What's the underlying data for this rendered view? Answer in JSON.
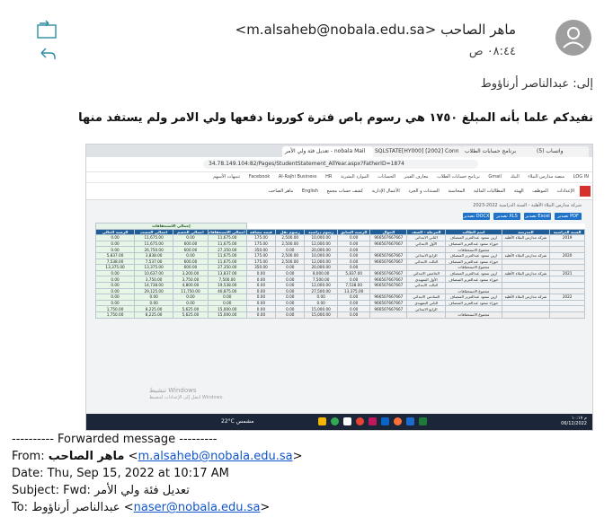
{
  "sender": {
    "name": "ماهر الصاحب",
    "email": "m.alsaheb@nobala.edu.sa",
    "time": "٠٨:٤٤ ص"
  },
  "to_line": "إلى: عبدالناصر أرناؤوط",
  "message_body": "نفيدكم علما بأنه المبلغ ١٧٥٠ هي رسوم باص فترة كورونا دفعها ولي الامر ولم يستفد منها",
  "screenshot": {
    "tabs": [
      "(5) واتساب",
      "برنامج حسابات الطلاب",
      "SQLSTATE[HY000] [2002] Conn",
      "تعديل فئة ولي الأمر - nobala Mail"
    ],
    "url": "34.78.149.104:82/Pages/StudentStatement_AllYear.aspx?FatherID=1874",
    "bookmarks": [
      "LOG IN",
      "منصة مدارس النبلاء",
      "البنك",
      "Gmail",
      "برنامج حسابات الطلاب",
      "معارف الفيتر",
      "الحسابات",
      "الموارد البشرية",
      "HR",
      "Al-Rajhi Business",
      "Facebook",
      "تنبيهات الأسهم"
    ],
    "nav_items": [
      "الإعدادات",
      "الموظف",
      "الهيئة",
      "المطالبات المالية",
      "المحاسبة",
      "السندات و الجرد",
      "الأعمال الإدارية",
      "كشف حساب مجمع",
      "English",
      "ماهر الصاحب"
    ],
    "crumb": "شركة مدارس النبلاء الأهلية - السنة الدراسية 2022-2023",
    "buttons": [
      "تصدير PDF",
      "تصدير Excel",
      "تصدير XLS",
      "تصدير DOCX"
    ],
    "column_headers": [
      "السنة الدراسية",
      "المدرسة",
      "اسم الطالب",
      "المرحلة - الصف",
      "الجوال",
      "الرصيد السابق",
      "رسوم دراسية",
      "رسوم نقل",
      "قيمة مضافة",
      "اجمالي الاستحقاقات",
      "اجمالي الخصم",
      "اجمالي المسدد",
      "الرصيد الحالي"
    ],
    "group_header": "إجمالي الاستحقاقات",
    "years": [
      "2019",
      "2020",
      "2021",
      "2022"
    ],
    "school": "شركة مدارس النبلاء الأهلية",
    "rows": [
      [
        "",
        "",
        "ارين سعود عبدالعزيز المنصاف",
        "الثاني الابتدائي",
        "966507667667",
        "0.00",
        "10,000.00",
        "2,500.00",
        "175.00",
        "11,675.00",
        "0.00",
        "11,675.00",
        "0.00"
      ],
      [
        "",
        "",
        "حوراء سعود عبدالعزيز المنصاف",
        "الأول الابتدائي",
        "966507667667",
        "0.00",
        "12,000.00",
        "2,500.00",
        "175.00",
        "11,675.00",
        "600.00",
        "11,675.00",
        "0.00"
      ],
      [
        "",
        "",
        "مجموع الاستحقاقات",
        "",
        "",
        "0.00",
        "20,000.00",
        "0.00",
        "350.00",
        "27,350.00",
        "600.00",
        "26,750.00",
        "0.00"
      ],
      [
        "",
        "",
        "ارين سعود عبدالعزيز المنصاف",
        "الرابع الابتدائي",
        "966507667667",
        "0.00",
        "10,000.00",
        "2,500.00",
        "175.00",
        "11,675.00",
        "0.00",
        "3,838.00",
        "5,837.00"
      ],
      [
        "",
        "",
        "حوراء سعود عبدالعزيز المنصاف",
        "الثالث الابتدائي",
        "966507667667",
        "0.00",
        "12,000.00",
        "2,500.00",
        "175.00",
        "11,675.00",
        "600.00",
        "7,537.00",
        "7,538.00"
      ],
      [
        "",
        "",
        "مجموع الاستحقاقات",
        "",
        "",
        "0.00",
        "20,000.00",
        "0.00",
        "350.00",
        "27,350.00",
        "600.00",
        "13,375.00",
        "13,375.00"
      ],
      [
        "",
        "",
        "ارين سعود عبدالعزيز المنصاف",
        "الخامس الابتدائي",
        "966507667667",
        "5,837.00",
        "8,000.00",
        "0.00",
        "0.00",
        "13,837.00",
        "3,200.00",
        "10,637.00",
        "0.00"
      ],
      [
        "",
        "",
        "حوراء سعود عبدالعزيز المنصاف",
        "الأول التمهيدي",
        "966507667667",
        "0.00",
        "7,500.00",
        "0.00",
        "0.00",
        "7,500.00",
        "3,750.00",
        "3,750.00",
        "0.00"
      ],
      [
        "",
        "",
        "",
        "الثالث الابتدائي",
        "966507667667",
        "7,538.00",
        "12,000.00",
        "0.00",
        "0.00",
        "19,538.00",
        "4,800.00",
        "14,738.00",
        "0.00"
      ],
      [
        "",
        "",
        "مجموع الاستحقاقات",
        "",
        "",
        "13,375.00",
        "27,500.00",
        "0.00",
        "0.00",
        "40,875.00",
        "11,750.00",
        "29,125.00",
        "0.00"
      ],
      [
        "",
        "",
        "ارين سعود عبدالعزيز المنصاف",
        "السادس الابتدائي",
        "966507667667",
        "0.00",
        "0.00",
        "0.00",
        "0.00",
        "0.00",
        "0.00",
        "0.00",
        "0.00"
      ],
      [
        "",
        "",
        "حوراء سعود عبدالعزيز المنصاف",
        "الثاني التمهيدي",
        "966507667667",
        "0.00",
        "0.00",
        "0.00",
        "0.00",
        "0.00",
        "0.00",
        "0.00",
        "0.00"
      ],
      [
        "",
        "",
        "",
        "الرابع الابتدائي",
        "966507667667",
        "0.00",
        "15,000.00",
        "0.00",
        "0.00",
        "15,000.00",
        "5,625.00",
        "8,225.00",
        "1,750.00"
      ],
      [
        "",
        "",
        "مجموع الاستحقاقات",
        "",
        "",
        "0.00",
        "15,000.00",
        "0.00",
        "0.00",
        "15,000.00",
        "5,625.00",
        "8,225.00",
        "1,750.00"
      ]
    ],
    "watermark": "تنشيط Windows",
    "watermark_sub": "انتقل إلى الإعدادات لتنشيط Windows.",
    "taskbar_weather": "22°C مشمس",
    "taskbar_time": "م ١٠:١٧",
    "taskbar_date": "06/12/2022"
  },
  "forwarded": {
    "divider": "---------- Forwarded message ---------",
    "from_label": "From: ",
    "from_name": "ماهر الصاحب",
    "from_email": "m.alsaheb@nobala.edu.sa",
    "date": "Date: Thu, Sep 15, 2022 at 10:17 AM",
    "subject_label": "Subject: Fwd: ",
    "subject": "تعديل فئة ولي الأمر",
    "to_label": "To: ",
    "to_name": "عبدالناصر أرناؤوط",
    "to_email": "naser@nobala.edu.sa"
  },
  "colors": {
    "avatar": "#9e9e9e",
    "link": "#1155cc",
    "icon_teal": "#00838f",
    "table_header": "#1f5e99",
    "green_cell": "#e8f6e8"
  }
}
